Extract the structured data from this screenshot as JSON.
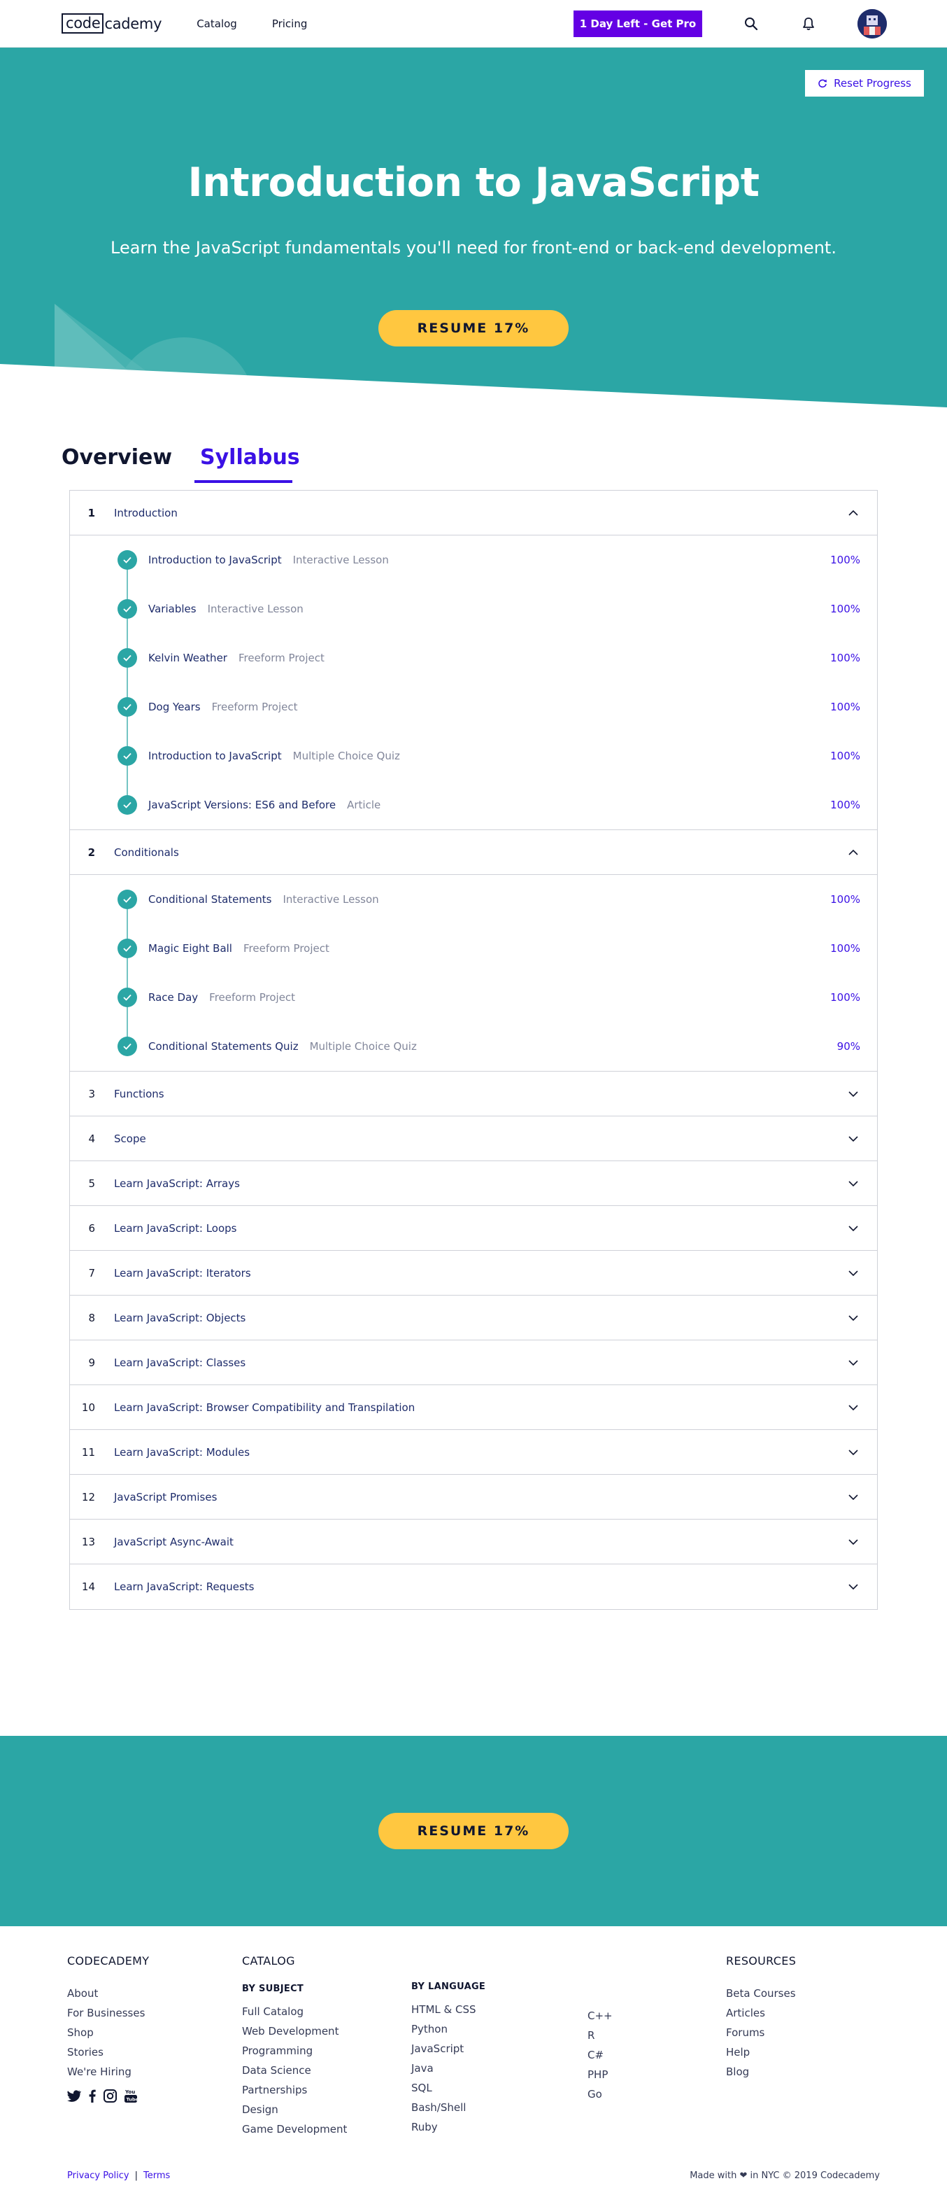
{
  "header": {
    "logo_left": "code",
    "logo_right": "cademy",
    "nav": [
      "Catalog",
      "Pricing"
    ],
    "pro_button": "1 Day Left - Get Pro"
  },
  "hero": {
    "reset_label": "Reset Progress",
    "title": "Introduction to JavaScript",
    "subtitle": "Learn the JavaScript fundamentals you'll need for front-end or back-end development.",
    "resume_label": "RESUME 17%"
  },
  "tabs": {
    "overview": "Overview",
    "syllabus": "Syllabus"
  },
  "modules": [
    {
      "num": "1",
      "title": "Introduction",
      "expanded": true,
      "lessons": [
        {
          "name": "Introduction to JavaScript",
          "type": "Interactive Lesson",
          "pct": "100%"
        },
        {
          "name": "Variables",
          "type": "Interactive Lesson",
          "pct": "100%"
        },
        {
          "name": "Kelvin Weather",
          "type": "Freeform Project",
          "pct": "100%"
        },
        {
          "name": "Dog Years",
          "type": "Freeform Project",
          "pct": "100%"
        },
        {
          "name": "Introduction to JavaScript",
          "type": "Multiple Choice Quiz",
          "pct": "100%"
        },
        {
          "name": "JavaScript Versions: ES6 and Before",
          "type": "Article",
          "pct": "100%"
        }
      ]
    },
    {
      "num": "2",
      "title": "Conditionals",
      "expanded": true,
      "lessons": [
        {
          "name": "Conditional Statements",
          "type": "Interactive Lesson",
          "pct": "100%"
        },
        {
          "name": "Magic Eight Ball",
          "type": "Freeform Project",
          "pct": "100%"
        },
        {
          "name": "Race Day",
          "type": "Freeform Project",
          "pct": "100%"
        },
        {
          "name": "Conditional Statements Quiz",
          "type": "Multiple Choice Quiz",
          "pct": "90%"
        }
      ]
    },
    {
      "num": "3",
      "title": "Functions",
      "expanded": false
    },
    {
      "num": "4",
      "title": "Scope",
      "expanded": false
    },
    {
      "num": "5",
      "title": "Learn JavaScript: Arrays",
      "expanded": false
    },
    {
      "num": "6",
      "title": "Learn JavaScript: Loops",
      "expanded": false
    },
    {
      "num": "7",
      "title": "Learn JavaScript: Iterators",
      "expanded": false
    },
    {
      "num": "8",
      "title": "Learn JavaScript: Objects",
      "expanded": false
    },
    {
      "num": "9",
      "title": "Learn JavaScript: Classes",
      "expanded": false
    },
    {
      "num": "10",
      "title": "Learn JavaScript: Browser Compatibility and Transpilation",
      "expanded": false
    },
    {
      "num": "11",
      "title": "Learn JavaScript: Modules",
      "expanded": false
    },
    {
      "num": "12",
      "title": "JavaScript Promises",
      "expanded": false
    },
    {
      "num": "13",
      "title": "JavaScript Async-Await",
      "expanded": false
    },
    {
      "num": "14",
      "title": "Learn JavaScript: Requests",
      "expanded": false
    }
  ],
  "band": {
    "resume_label": "RESUME 17%"
  },
  "footer": {
    "codecademy": {
      "heading": "CODECADEMY",
      "links": [
        "About",
        "For Businesses",
        "Shop",
        "Stories",
        "We're Hiring"
      ]
    },
    "catalog": {
      "heading": "CATALOG",
      "by_subject_heading": "BY SUBJECT",
      "by_subject": [
        "Full Catalog",
        "Web Development",
        "Programming",
        "Data Science",
        "Partnerships",
        "Design",
        "Game Development"
      ],
      "by_language_heading": "BY LANGUAGE",
      "by_language_1": [
        "HTML & CSS",
        "Python",
        "JavaScript",
        "Java",
        "SQL",
        "Bash/Shell",
        "Ruby"
      ],
      "by_language_2": [
        "C++",
        "R",
        "C#",
        "PHP",
        "Go"
      ]
    },
    "resources": {
      "heading": "RESOURCES",
      "links": [
        "Beta Courses",
        "Articles",
        "Forums",
        "Help",
        "Blog"
      ]
    },
    "privacy": "Privacy Policy",
    "separator": "|",
    "terms": "Terms",
    "made_with": "Made with ❤ in NYC © 2019 Codecademy"
  },
  "colors": {
    "teal": "#2ba6a5",
    "pro_purple": "#6400e4",
    "accent_blue": "#3a10e5",
    "resume_yellow": "#ffc740",
    "navy": "#10162f"
  }
}
